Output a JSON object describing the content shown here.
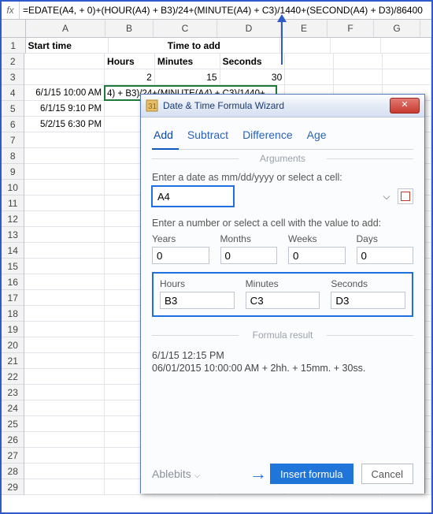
{
  "formula_bar": {
    "fx": "fx",
    "formula": "=EDATE(A4, + 0)+(HOUR(A4) + B3)/24+(MINUTE(A4) + C3)/1440+(SECOND(A4) + D3)/86400"
  },
  "columns": [
    "A",
    "B",
    "C",
    "D",
    "E",
    "F",
    "G"
  ],
  "headers": {
    "A1": "Start time",
    "BCD1": "Time to add",
    "B2": "Hours",
    "C2": "Minutes",
    "D2": "Seconds"
  },
  "row3_vals": {
    "B": "2",
    "C": "15",
    "D": "30"
  },
  "dates": {
    "A4": "6/1/15 10:00 AM",
    "A5": "6/1/15 9:10 PM",
    "A6": "5/2/15 6:30 PM"
  },
  "selected_cell_display": "4) + B3)/24+(MINUTE(A4) + C3)/1440+",
  "dialog": {
    "title": "Date & Time Formula Wizard",
    "tabs": [
      "Add",
      "Subtract",
      "Difference",
      "Age"
    ],
    "arguments_label": "Arguments",
    "date_label": "Enter a date as mm/dd/yyyy or select a cell:",
    "date_value": "A4",
    "number_label": "Enter a number or select a cell with the value to add:",
    "fields_top": {
      "Years": "0",
      "Months": "0",
      "Weeks": "0",
      "Days": "0"
    },
    "fields_time": {
      "Hours": "B3",
      "Minutes": "C3",
      "Seconds": "D3"
    },
    "result_label": "Formula result",
    "result1": "6/1/15 12:15 PM",
    "result2": "06/01/2015 10:00:00 AM + 2hh. + 15mm. + 30ss.",
    "brand": "Ablebits",
    "insert_btn": "Insert formula",
    "cancel_btn": "Cancel",
    "close_glyph": "✕"
  }
}
